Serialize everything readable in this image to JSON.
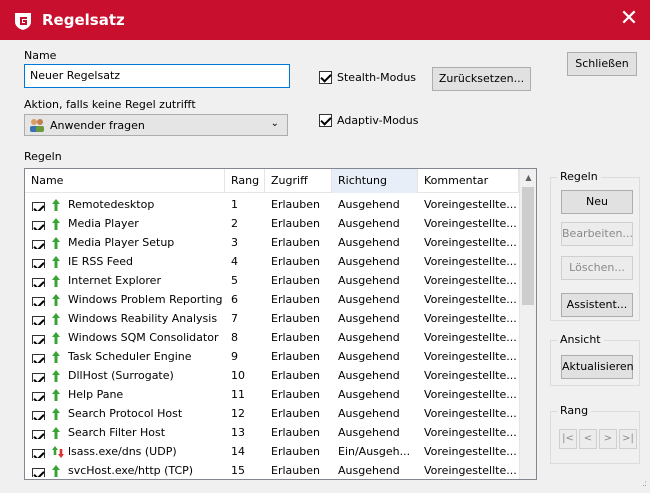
{
  "window": {
    "title": "Regelsatz",
    "close_glyph": "✕",
    "accent_color": "#c8102e"
  },
  "form": {
    "name_label": "Name",
    "name_value": "Neuer Regelsatz",
    "stealth_label": "Stealth-Modus",
    "reset_button": "Zurücksetzen...",
    "close_button": "Schließen",
    "action_label": "Aktion, falls keine Regel zutrifft",
    "action_value": "Anwender fragen",
    "adaptive_label": "Adaptiv-Modus",
    "rules_label": "Regeln"
  },
  "table": {
    "columns": [
      "Name",
      "Rang",
      "Zugriff",
      "Richtung",
      "Kommentar"
    ],
    "rows": [
      {
        "name": "Remotedesktop",
        "rank": "1",
        "access": "Erlauben",
        "direction": "Ausgehend",
        "comment": "Voreingestellte...",
        "icon": "arrow-up-icon"
      },
      {
        "name": "Media Player",
        "rank": "2",
        "access": "Erlauben",
        "direction": "Ausgehend",
        "comment": "Voreingestellte...",
        "icon": "arrow-up-icon"
      },
      {
        "name": "Media Player Setup",
        "rank": "3",
        "access": "Erlauben",
        "direction": "Ausgehend",
        "comment": "Voreingestellte...",
        "icon": "arrow-up-icon"
      },
      {
        "name": "IE RSS Feed",
        "rank": "4",
        "access": "Erlauben",
        "direction": "Ausgehend",
        "comment": "Voreingestellte...",
        "icon": "arrow-up-icon"
      },
      {
        "name": "Internet Explorer",
        "rank": "5",
        "access": "Erlauben",
        "direction": "Ausgehend",
        "comment": "Voreingestellte...",
        "icon": "arrow-up-icon"
      },
      {
        "name": "Windows Problem Reporting",
        "rank": "6",
        "access": "Erlauben",
        "direction": "Ausgehend",
        "comment": "Voreingestellte...",
        "icon": "arrow-up-icon"
      },
      {
        "name": "Windows Reability Analysis",
        "rank": "7",
        "access": "Erlauben",
        "direction": "Ausgehend",
        "comment": "Voreingestellte...",
        "icon": "arrow-up-icon"
      },
      {
        "name": "Windows SQM Consolidator",
        "rank": "8",
        "access": "Erlauben",
        "direction": "Ausgehend",
        "comment": "Voreingestellte...",
        "icon": "arrow-up-icon"
      },
      {
        "name": "Task Scheduler Engine",
        "rank": "9",
        "access": "Erlauben",
        "direction": "Ausgehend",
        "comment": "Voreingestellte...",
        "icon": "arrow-up-icon"
      },
      {
        "name": "DllHost (Surrogate)",
        "rank": "10",
        "access": "Erlauben",
        "direction": "Ausgehend",
        "comment": "Voreingestellte...",
        "icon": "arrow-up-icon"
      },
      {
        "name": "Help Pane",
        "rank": "11",
        "access": "Erlauben",
        "direction": "Ausgehend",
        "comment": "Voreingestellte...",
        "icon": "arrow-up-icon"
      },
      {
        "name": "Search Protocol Host",
        "rank": "12",
        "access": "Erlauben",
        "direction": "Ausgehend",
        "comment": "Voreingestellte...",
        "icon": "arrow-up-icon"
      },
      {
        "name": "Search Filter Host",
        "rank": "13",
        "access": "Erlauben",
        "direction": "Ausgehend",
        "comment": "Voreingestellte...",
        "icon": "arrow-up-icon"
      },
      {
        "name": "lsass.exe/dns (UDP)",
        "rank": "14",
        "access": "Erlauben",
        "direction": "Ein/Ausgeh...",
        "comment": "Voreingestellte...",
        "icon": "arrow-both-icon"
      },
      {
        "name": "svcHost.exe/http (TCP)",
        "rank": "15",
        "access": "Erlauben",
        "direction": "Ausgehend",
        "comment": "Voreingestellte...",
        "icon": "arrow-up-icon"
      }
    ]
  },
  "panel_rules": {
    "title": "Regeln",
    "new": "Neu",
    "edit": "Bearbeiten...",
    "delete": "Löschen...",
    "wizard": "Assistent..."
  },
  "panel_view": {
    "title": "Ansicht",
    "refresh": "Aktualisieren"
  },
  "panel_rank": {
    "title": "Rang",
    "first": "|<",
    "prev": "<",
    "next": ">",
    "last": ">|"
  }
}
